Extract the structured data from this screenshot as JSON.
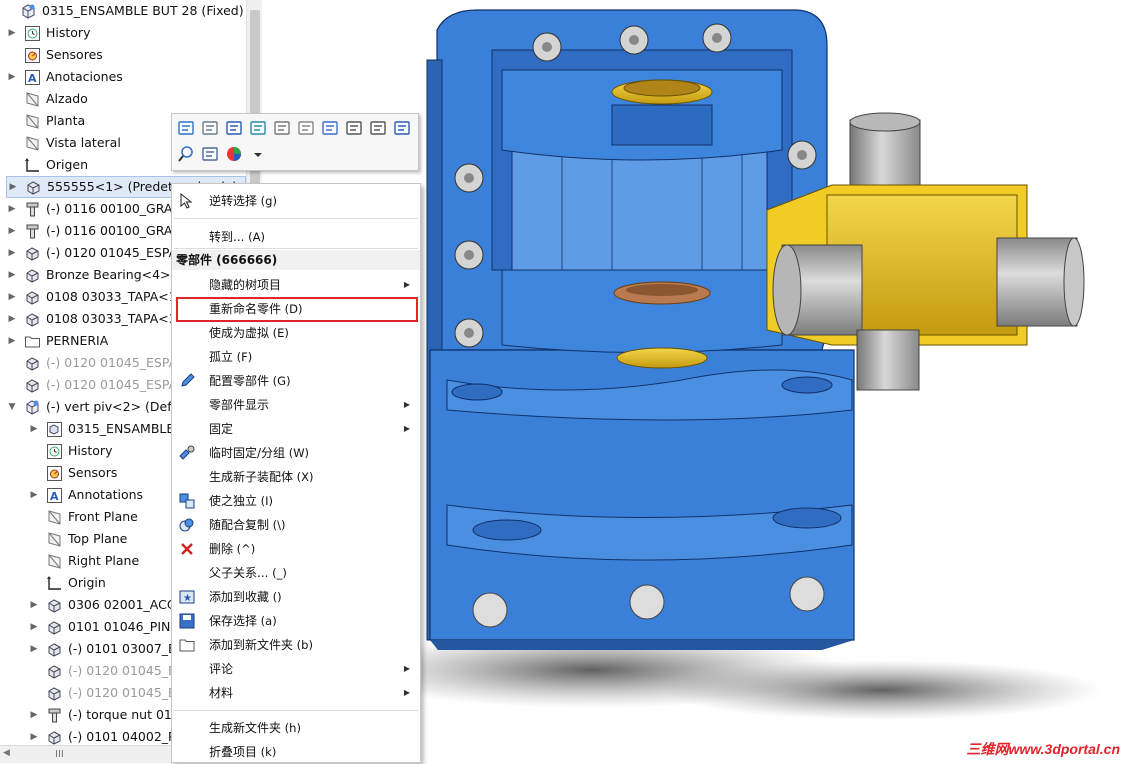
{
  "tree": {
    "items": [
      {
        "label": "0315_ENSAMBLE BUT 28  (Fixed)",
        "icon": "assembly-icon",
        "expand": ""
      },
      {
        "label": "History",
        "icon": "history-icon",
        "expand": "▶"
      },
      {
        "label": "Sensores",
        "icon": "sensor-icon",
        "expand": ""
      },
      {
        "label": "Anotaciones",
        "icon": "annotation-icon",
        "expand": "▶"
      },
      {
        "label": "Alzado",
        "icon": "plane-icon",
        "expand": ""
      },
      {
        "label": "Planta",
        "icon": "plane-icon",
        "expand": ""
      },
      {
        "label": "Vista lateral",
        "icon": "plane-icon",
        "expand": ""
      },
      {
        "label": "Origen",
        "icon": "origin-icon",
        "expand": ""
      },
      {
        "label": "555555<1> (Predeterminado)",
        "icon": "part-icon",
        "expand": "▶"
      },
      {
        "label": "(-) 0116 00100_GRAS",
        "icon": "bolt-icon",
        "expand": "▶"
      },
      {
        "label": "(-) 0116 00100_GRAS",
        "icon": "bolt-icon",
        "expand": "▶"
      },
      {
        "label": "(-) 0120 01045_ESPA",
        "icon": "part-icon",
        "expand": "▶"
      },
      {
        "label": "Bronze Bearing<4>",
        "icon": "part-icon",
        "expand": "▶"
      },
      {
        "label": "0108 03033_TAPA<1",
        "icon": "part-icon",
        "expand": "▶"
      },
      {
        "label": "0108 03033_TAPA<3",
        "icon": "part-icon",
        "expand": "▶"
      },
      {
        "label": "PERNERIA",
        "icon": "folder-icon",
        "expand": "▶"
      },
      {
        "label": "(-) 0120 01045_ESPA",
        "icon": "part-icon",
        "expand": "",
        "dim": true
      },
      {
        "label": "(-) 0120 01045_ESPA",
        "icon": "part-icon",
        "expand": "",
        "dim": true
      },
      {
        "label": "(-) vert piv<2> (Defa",
        "icon": "assembly-icon",
        "expand": "▼"
      },
      {
        "label": "0315_ENSAMBLE",
        "icon": "subassembly-icon",
        "expand": "▶"
      },
      {
        "label": "History",
        "icon": "history-icon",
        "expand": ""
      },
      {
        "label": "Sensors",
        "icon": "sensor-icon",
        "expand": ""
      },
      {
        "label": "Annotations",
        "icon": "annotation-icon",
        "expand": "▶"
      },
      {
        "label": "Front Plane",
        "icon": "plane-icon",
        "expand": ""
      },
      {
        "label": "Top Plane",
        "icon": "plane-icon",
        "expand": ""
      },
      {
        "label": "Right Plane",
        "icon": "plane-icon",
        "expand": ""
      },
      {
        "label": "Origin",
        "icon": "origin-icon",
        "expand": ""
      },
      {
        "label": "0306 02001_ACC",
        "icon": "part-icon",
        "expand": "▶"
      },
      {
        "label": "0101 01046_PIN",
        "icon": "part-icon",
        "expand": "▶"
      },
      {
        "label": "(-) 0101 03007_B",
        "icon": "part-icon",
        "expand": "▶"
      },
      {
        "label": "(-) 0120 01045_E",
        "icon": "part-icon",
        "expand": "",
        "dim": true
      },
      {
        "label": "(-) 0120 01045_E",
        "icon": "part-icon",
        "expand": "",
        "dim": true
      },
      {
        "label": "(-) torque nut 01",
        "icon": "bolt-icon",
        "expand": "▶"
      },
      {
        "label": "(-) 0101 04002_P",
        "icon": "part-icon",
        "expand": "▶"
      }
    ],
    "scroll_grip": "III"
  },
  "toolbar": {
    "icons": [
      "open-part-icon",
      "edit-feature-icon",
      "drawing-icon",
      "appearance-icon",
      "hide-icon",
      "suppress-icon",
      "rebuild-icon",
      "attachment-icon",
      "link-icon",
      "properties-icon",
      "zoom-selection-icon",
      "isolate-icon",
      "color-ball-icon",
      "dropdown-icon"
    ]
  },
  "menu": {
    "header": "零部件 (666666)",
    "items": [
      {
        "label": "逆转选择",
        "key": "(g)",
        "icon": "invert-select-icon"
      },
      {
        "label": "转到...",
        "key": "(A)",
        "icon": ""
      },
      {
        "label": "隐藏的树项目",
        "key": "",
        "icon": "",
        "submenu": true
      },
      {
        "label": "重新命名零件",
        "key": "(D)",
        "icon": ""
      },
      {
        "label": "使成为虚拟",
        "key": "(E)",
        "icon": ""
      },
      {
        "label": "孤立",
        "key": "(F)",
        "icon": ""
      },
      {
        "label": "配置零部件",
        "key": "(G)",
        "icon": "pencil-icon"
      },
      {
        "label": "零部件显示",
        "key": "",
        "icon": "",
        "submenu": true
      },
      {
        "label": "固定",
        "key": "",
        "icon": "",
        "submenu": true
      },
      {
        "label": "临时固定/分组",
        "key": "(W)",
        "icon": "temp-fix-icon"
      },
      {
        "label": "生成新子装配体",
        "key": "(X)",
        "icon": ""
      },
      {
        "label": "使之独立",
        "key": "(I)",
        "icon": "make-independent-icon"
      },
      {
        "label": "随配合复制",
        "key": "(\\)",
        "icon": "copy-mates-icon"
      },
      {
        "label": "删除",
        "key": "(^)",
        "icon": "delete-icon"
      },
      {
        "label": "父子关系...",
        "key": "(_)",
        "icon": ""
      },
      {
        "label": "添加到收藏",
        "key": "()",
        "icon": "favorite-icon"
      },
      {
        "label": "保存选择",
        "key": "(a)",
        "icon": "save-selection-icon"
      },
      {
        "label": "添加到新文件夹",
        "key": "(b)",
        "icon": "folder-icon"
      },
      {
        "label": "评论",
        "key": "",
        "icon": "",
        "submenu": true
      },
      {
        "label": "材料",
        "key": "",
        "icon": "",
        "submenu": true
      },
      {
        "label": "生成新文件夹",
        "key": "(h)",
        "icon": ""
      },
      {
        "label": "折叠项目",
        "key": "(k)",
        "icon": ""
      }
    ],
    "highlight_color": "#e0252b"
  },
  "viewport": {
    "model": "gear-housing-model",
    "body_color": "#3a80d8",
    "bearing_color": "#e8c21a",
    "shaft_color": "#a9a9a9"
  },
  "watermark": "三维网www.3dportal.cn"
}
